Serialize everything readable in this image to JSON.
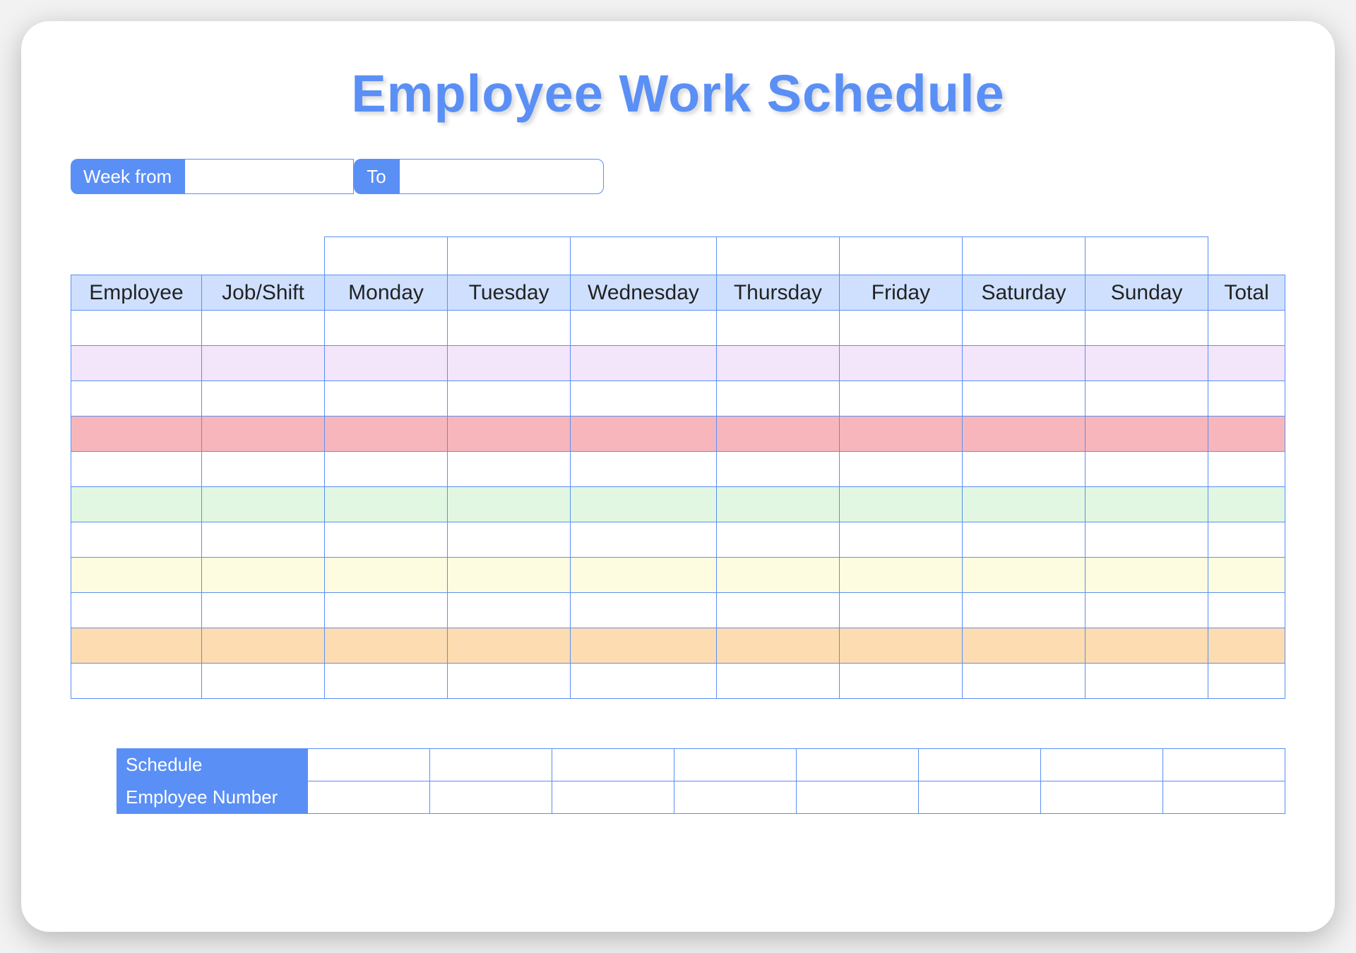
{
  "title": "Employee Work Schedule",
  "week": {
    "from_label": "Week from",
    "to_label": "To",
    "from_value": "",
    "to_value": ""
  },
  "headers": {
    "employee": "Employee",
    "job": "Job/Shift",
    "mon": "Monday",
    "tue": "Tuesday",
    "wed": "Wednesday",
    "thu": "Thursday",
    "fri": "Friday",
    "sat": "Saturday",
    "sun": "Sunday",
    "total": "Total"
  },
  "footer": {
    "schedule": "Schedule",
    "emp_num": "Employee Number"
  }
}
